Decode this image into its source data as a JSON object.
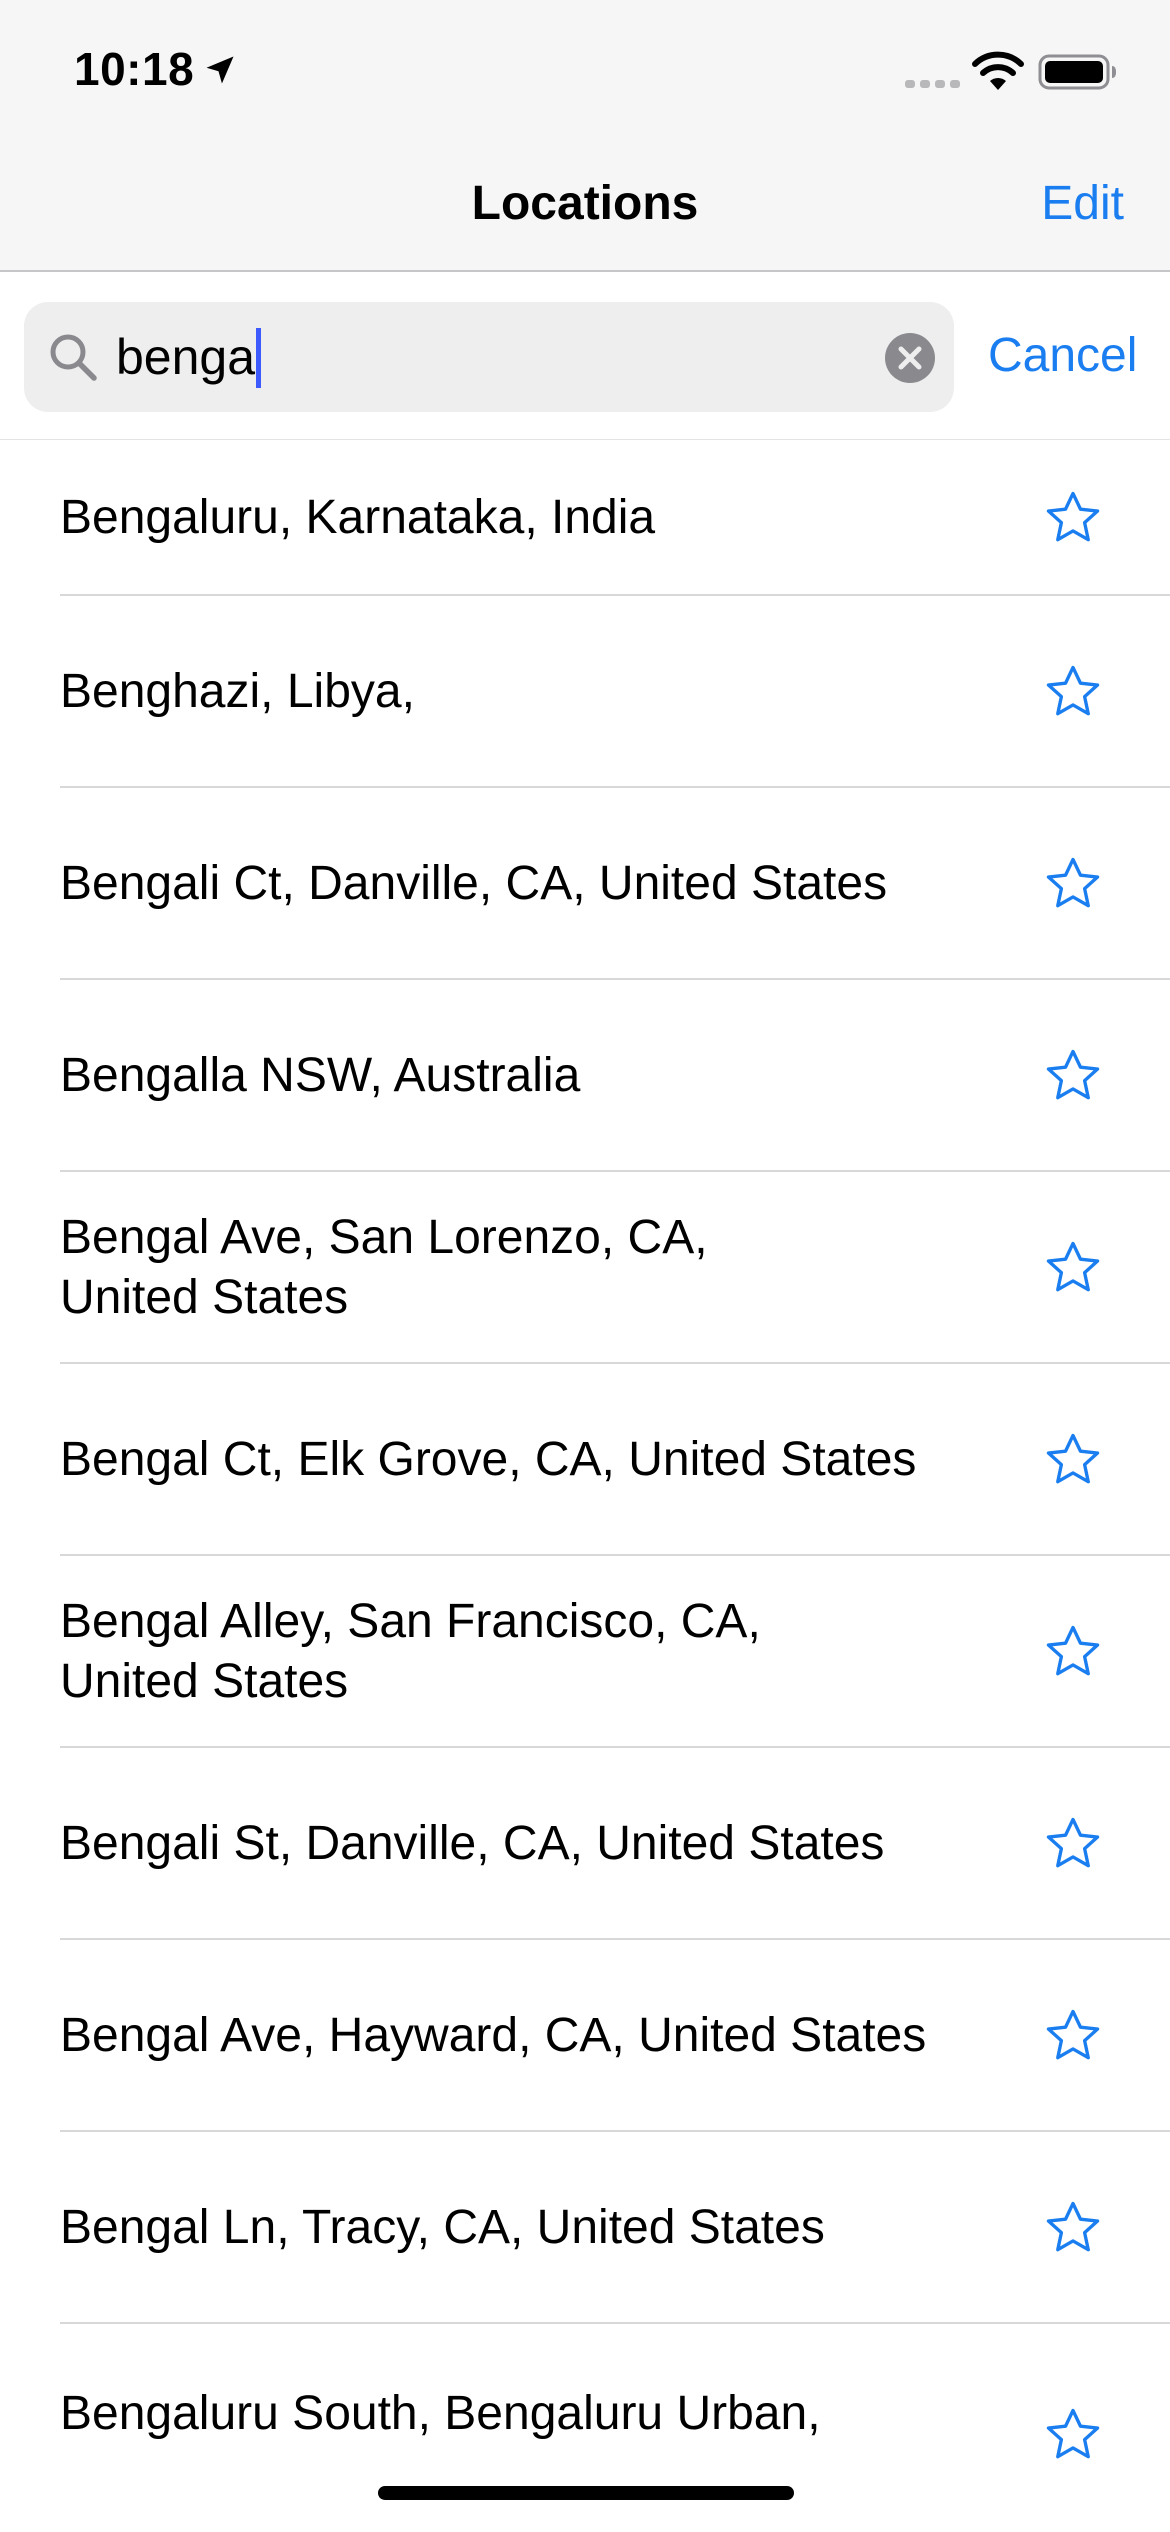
{
  "status_bar": {
    "time": "10:18"
  },
  "nav": {
    "title": "Locations",
    "edit_label": "Edit"
  },
  "search": {
    "value": "benga",
    "cancel_label": "Cancel"
  },
  "results": [
    {
      "label": "Bengaluru, Karnataka, India"
    },
    {
      "label": "Benghazi, Libya,"
    },
    {
      "label": "Bengali Ct, Danville, CA, United States"
    },
    {
      "label": "Bengalla NSW, Australia"
    },
    {
      "label": "Bengal Ave, San Lorenzo, CA,\nUnited States"
    },
    {
      "label": "Bengal Ct, Elk Grove, CA, United States"
    },
    {
      "label": "Bengal Alley, San Francisco, CA,\nUnited States"
    },
    {
      "label": "Bengali St, Danville, CA, United States"
    },
    {
      "label": "Bengal Ave, Hayward, CA, United States"
    },
    {
      "label": "Bengal Ln, Tracy, CA, United States"
    },
    {
      "label": "Bengaluru South, Bengaluru Urban,"
    }
  ],
  "colors": {
    "accent": "#1a7ef0",
    "nav_background": "#f6f6f6",
    "search_field_background": "#eeeeef",
    "separator": "#d8d8da"
  },
  "icons": {
    "location": "location-arrow-icon",
    "signal": "cellular-signal-icon",
    "wifi": "wifi-icon",
    "battery": "battery-icon",
    "search": "search-icon",
    "clear": "clear-icon",
    "favorite": "star-icon"
  }
}
